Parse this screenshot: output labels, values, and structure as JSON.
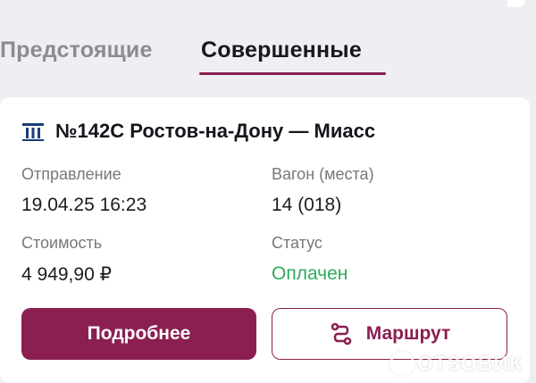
{
  "tabs": {
    "upcoming": "Предстоящие",
    "completed": "Совершенные"
  },
  "ticket": {
    "title": "№142С Ростов-на-Дону — Миасс",
    "departure_label": "Отправление",
    "departure_value": "19.04.25 16:23",
    "car_label": "Вагон (места)",
    "car_value": "14 (018)",
    "cost_label": "Стоимость",
    "cost_value": "4 949,90 ₽",
    "status_label": "Статус",
    "status_value": "Оплачен"
  },
  "buttons": {
    "details": "Подробнее",
    "route": "Маршрут"
  },
  "watermark": {
    "text": "ОТЗОВИК"
  },
  "icons": {
    "train": "train-icon",
    "route": "route-icon",
    "watermark": "watermark-logo-icon"
  },
  "colors": {
    "accent": "#8b1f51",
    "status_paid": "#2eaa5b",
    "background": "#eeeef3",
    "card": "#ffffff"
  }
}
